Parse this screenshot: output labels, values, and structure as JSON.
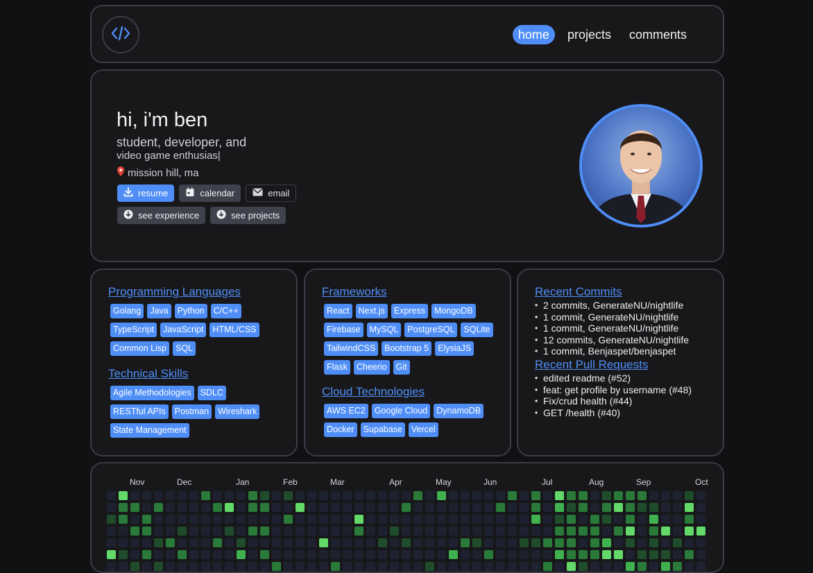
{
  "nav": {
    "logo_icon": "code-icon",
    "links": [
      {
        "label": "home",
        "active": true
      },
      {
        "label": "projects",
        "active": false
      },
      {
        "label": "comments",
        "active": false
      }
    ]
  },
  "hero": {
    "title": "hi, i'm ben",
    "subtitle": "student, developer, and",
    "typed_text": "video game enthusias|",
    "location": "mission hill, ma",
    "location_icon": "pin-icon",
    "buttons_row1": [
      {
        "label": "resume",
        "icon": "download-icon"
      },
      {
        "label": "calendar",
        "icon": "calendar-icon"
      },
      {
        "label": "email",
        "icon": "mail-icon"
      }
    ],
    "buttons_row2": [
      {
        "label": "see experience",
        "icon": "arrow-down-circle-icon"
      },
      {
        "label": "see projects",
        "icon": "arrow-down-circle-icon"
      }
    ]
  },
  "skills": {
    "programming_title": "Programming Languages",
    "programming": [
      "Golang",
      "Java",
      "Python",
      "C/C++",
      "TypeScript",
      "JavaScript",
      "HTML/CSS",
      "Common Lisp",
      "SQL"
    ],
    "technical_title": "Technical Skills",
    "technical": [
      "Agile Methodologies",
      "SDLC",
      "RESTful APIs",
      "Postman",
      "Wireshark",
      "State Management"
    ],
    "frameworks_title": "Frameworks",
    "frameworks": [
      "React",
      "Next.js",
      "Express",
      "MongoDB",
      "Firebase",
      "MySQL",
      "PostgreSQL",
      "SQLite",
      "TailwindCSS",
      "Bootstrap 5",
      "ElysiaJS",
      "Flask",
      "Cheerio",
      "Git"
    ],
    "cloud_title": "Cloud Technologies",
    "cloud": [
      "AWS EC2",
      "Google Cloud",
      "DynamoDB",
      "Docker",
      "Supabase",
      "Vercel"
    ]
  },
  "github": {
    "commits_title": "Recent Commits",
    "commits": [
      "2 commits, GenerateNU/nightlife",
      "1 commit, GenerateNU/nightlife",
      "1 commit, GenerateNU/nightlife",
      "12 commits, GenerateNU/nightlife",
      "1 commit, Benjaspet/benjaspet"
    ],
    "prs_title": "Recent Pull Requests",
    "prs": [
      "edited readme (#52)",
      "feat: get profile by username (#48)",
      "Fix/crud health (#44)",
      "GET /health (#40)"
    ]
  },
  "contributions": {
    "months": [
      "Nov",
      "Dec",
      "Jan",
      "Feb",
      "Mar",
      "Apr",
      "May",
      "Jun",
      "Jul",
      "Aug",
      "Sep",
      "Oct"
    ],
    "colors": [
      "#1e2230",
      "#1f4d2b",
      "#2a7a3a",
      "#3fb24f",
      "#63d96a"
    ]
  }
}
